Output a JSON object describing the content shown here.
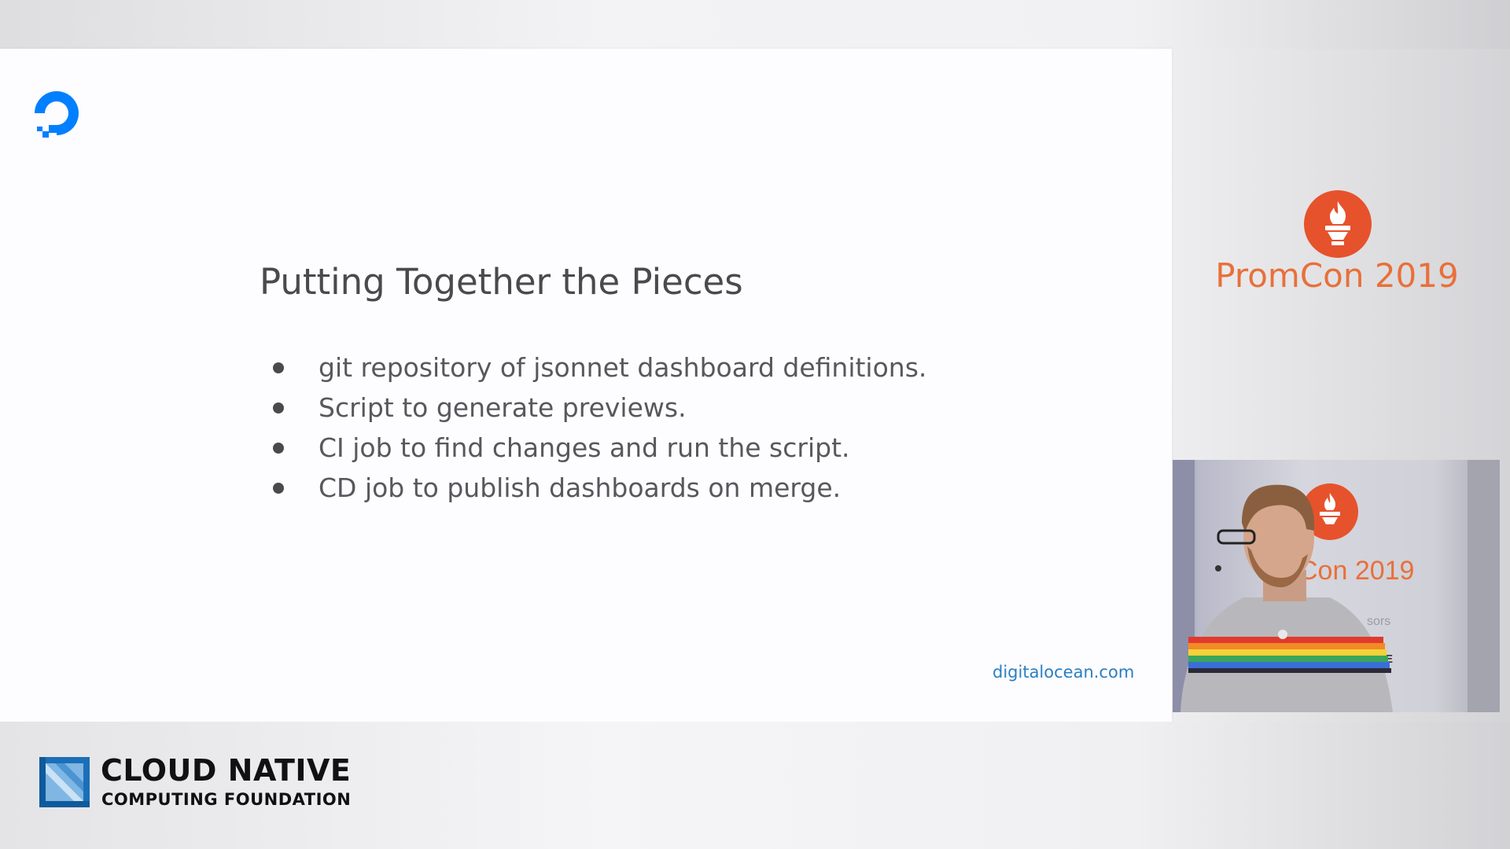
{
  "slide": {
    "title": "Putting Together the Pieces",
    "bullets": [
      "git repository of jsonnet dashboard definitions.",
      "Script to generate previews.",
      "CI job to find changes and run the script.",
      "CD job to publish dashboards on merge."
    ],
    "footer_url": "digitalocean.com",
    "logo_icon": "digitalocean-logo-icon"
  },
  "sidebar": {
    "event_name": "PromCon 2019",
    "logo_icon": "prometheus-torch-icon"
  },
  "camera": {
    "backdrop_text": "Con 2019",
    "backdrop_fragment": "sors",
    "backdrop_logo_fragment": "VE"
  },
  "footer": {
    "org_line1": "CLOUD NATIVE",
    "org_line2": "COMPUTING FOUNDATION",
    "logo_icon": "cncf-logo-icon"
  },
  "colors": {
    "digitalocean_blue": "#0080ff",
    "prometheus_orange": "#e6522c",
    "event_text_orange": "#e8703a",
    "link_blue": "#2a7fc1",
    "title_gray": "#4a4a4d",
    "bullet_gray": "#58585c"
  }
}
